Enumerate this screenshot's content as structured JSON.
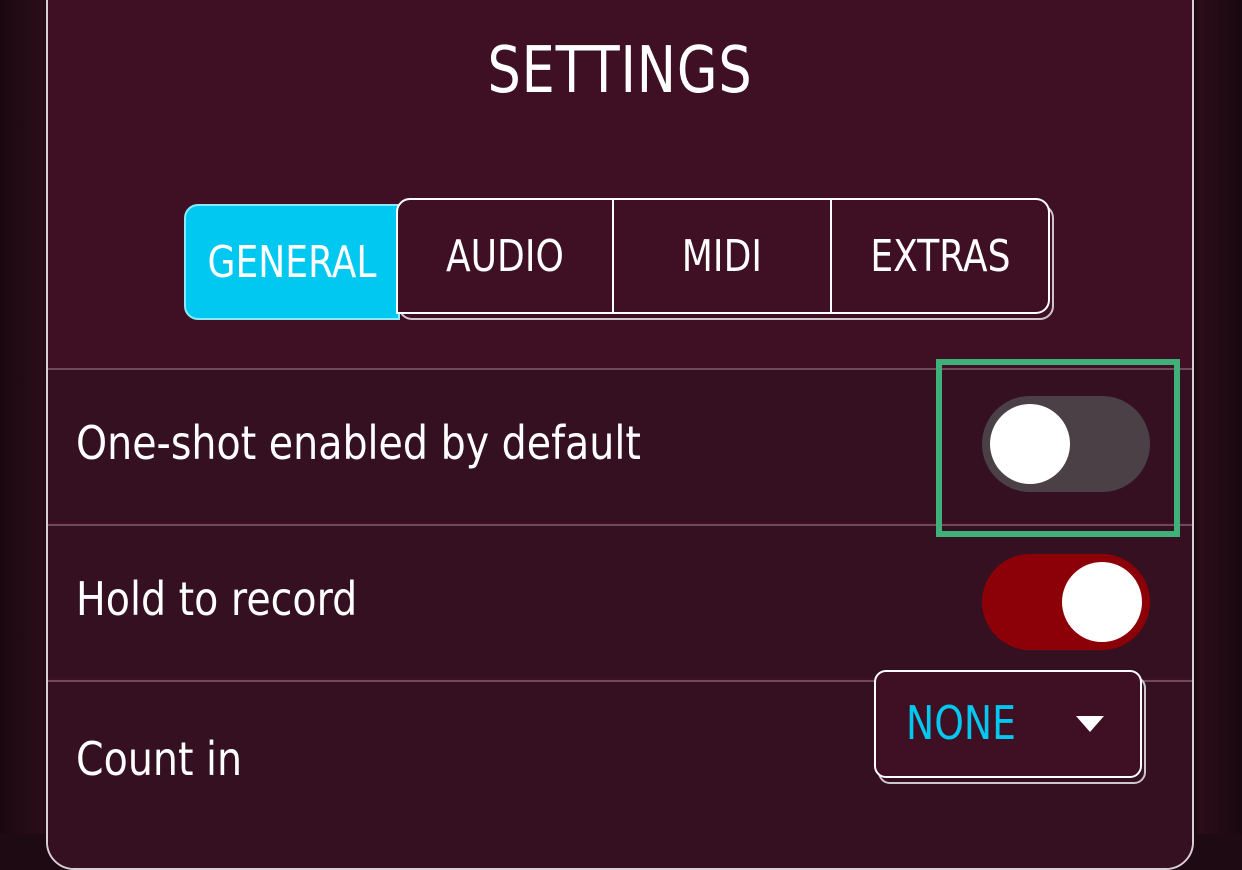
{
  "dialog": {
    "title": "SETTINGS"
  },
  "tabs": [
    {
      "label": "GENERAL",
      "active": true
    },
    {
      "label": "AUDIO",
      "active": false
    },
    {
      "label": "MIDI",
      "active": false
    },
    {
      "label": "EXTRAS",
      "active": false
    }
  ],
  "settings": {
    "one_shot": {
      "label": "One-shot enabled by default",
      "enabled": false
    },
    "hold_to_record": {
      "label": "Hold to record",
      "enabled": true
    },
    "count_in": {
      "label": "Count in",
      "value": "NONE"
    }
  },
  "colors": {
    "accent": "#00c8f0",
    "toggle_on": "#8c0008",
    "toggle_off": "#4a4046",
    "panel": "#3f1023",
    "highlight": "#3fb07a"
  },
  "icons": {
    "dropdown_caret": "chevron-down-icon"
  }
}
